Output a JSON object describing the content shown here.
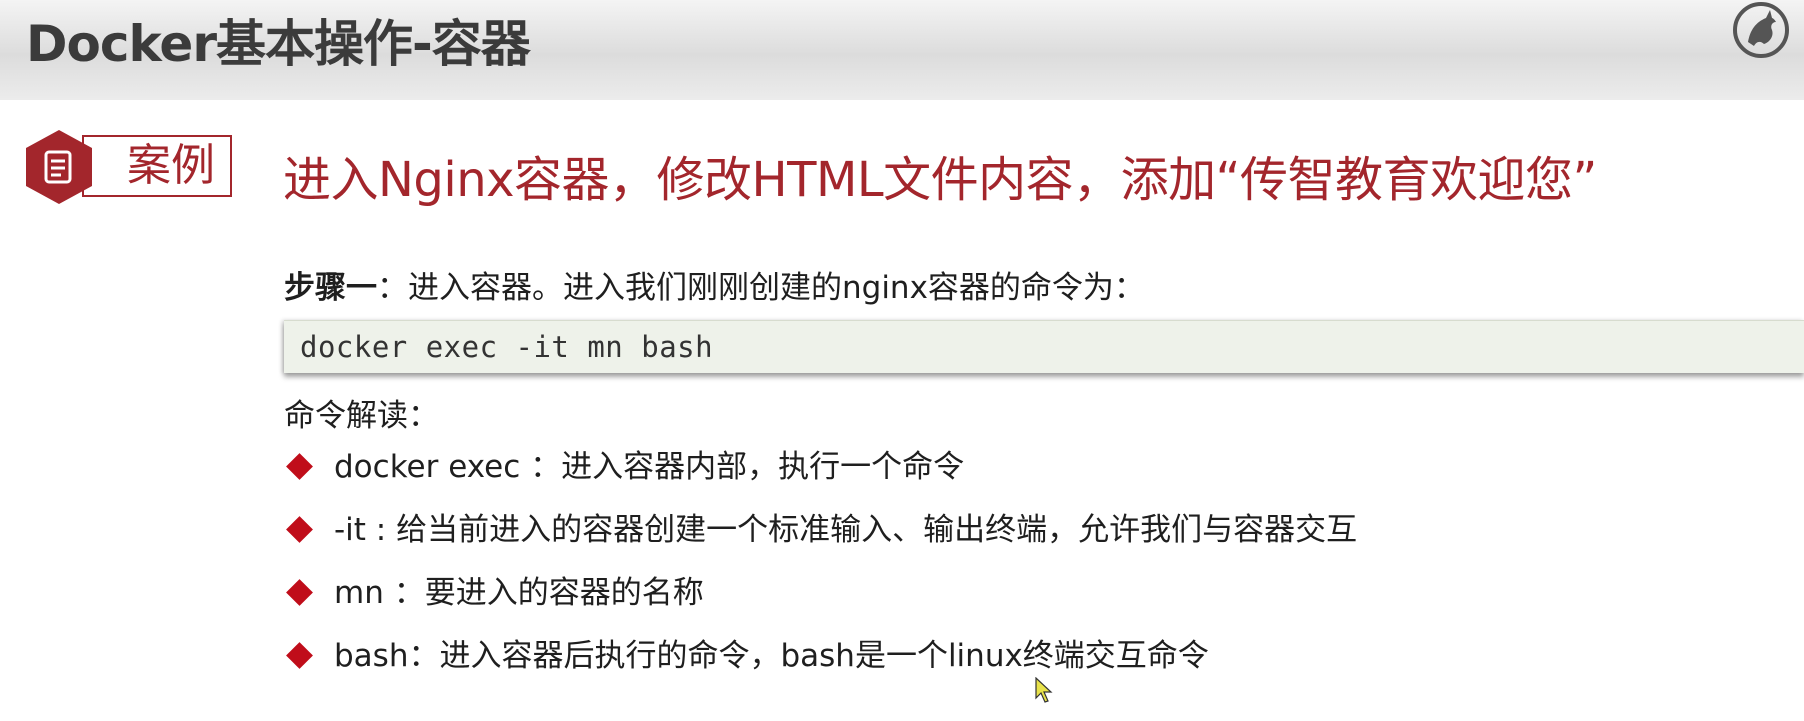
{
  "header": {
    "title": "Docker基本操作-容器",
    "logo_icon": "horse-logo-icon"
  },
  "case": {
    "badge_label": "案例",
    "badge_icon": "document-icon",
    "heading": "进入Nginx容器，修改HTML文件内容，添加“传智教育欢迎您”"
  },
  "step": {
    "title": "步骤一",
    "text": "：进入容器。进入我们刚刚创建的nginx容器的命令为："
  },
  "code": {
    "command": "docker exec -it mn bash"
  },
  "explanation": {
    "title": "命令解读：",
    "items": [
      {
        "text": "docker exec ：进入容器内部，执行一个命令"
      },
      {
        "text": "-it : 给当前进入的容器创建一个标准输入、输出终端，允许我们与容器交互"
      },
      {
        "text": "mn ：要进入的容器的名称"
      },
      {
        "text": "bash：进入容器后执行的命令，bash是一个linux终端交互命令"
      }
    ]
  },
  "colors": {
    "accent": "#a3262c",
    "bullet": "#c00d1a",
    "code_bg": "#eef2ea"
  },
  "icons": {
    "bullet": "diamond-bullet-icon",
    "cursor": "mouse-pointer-icon"
  }
}
